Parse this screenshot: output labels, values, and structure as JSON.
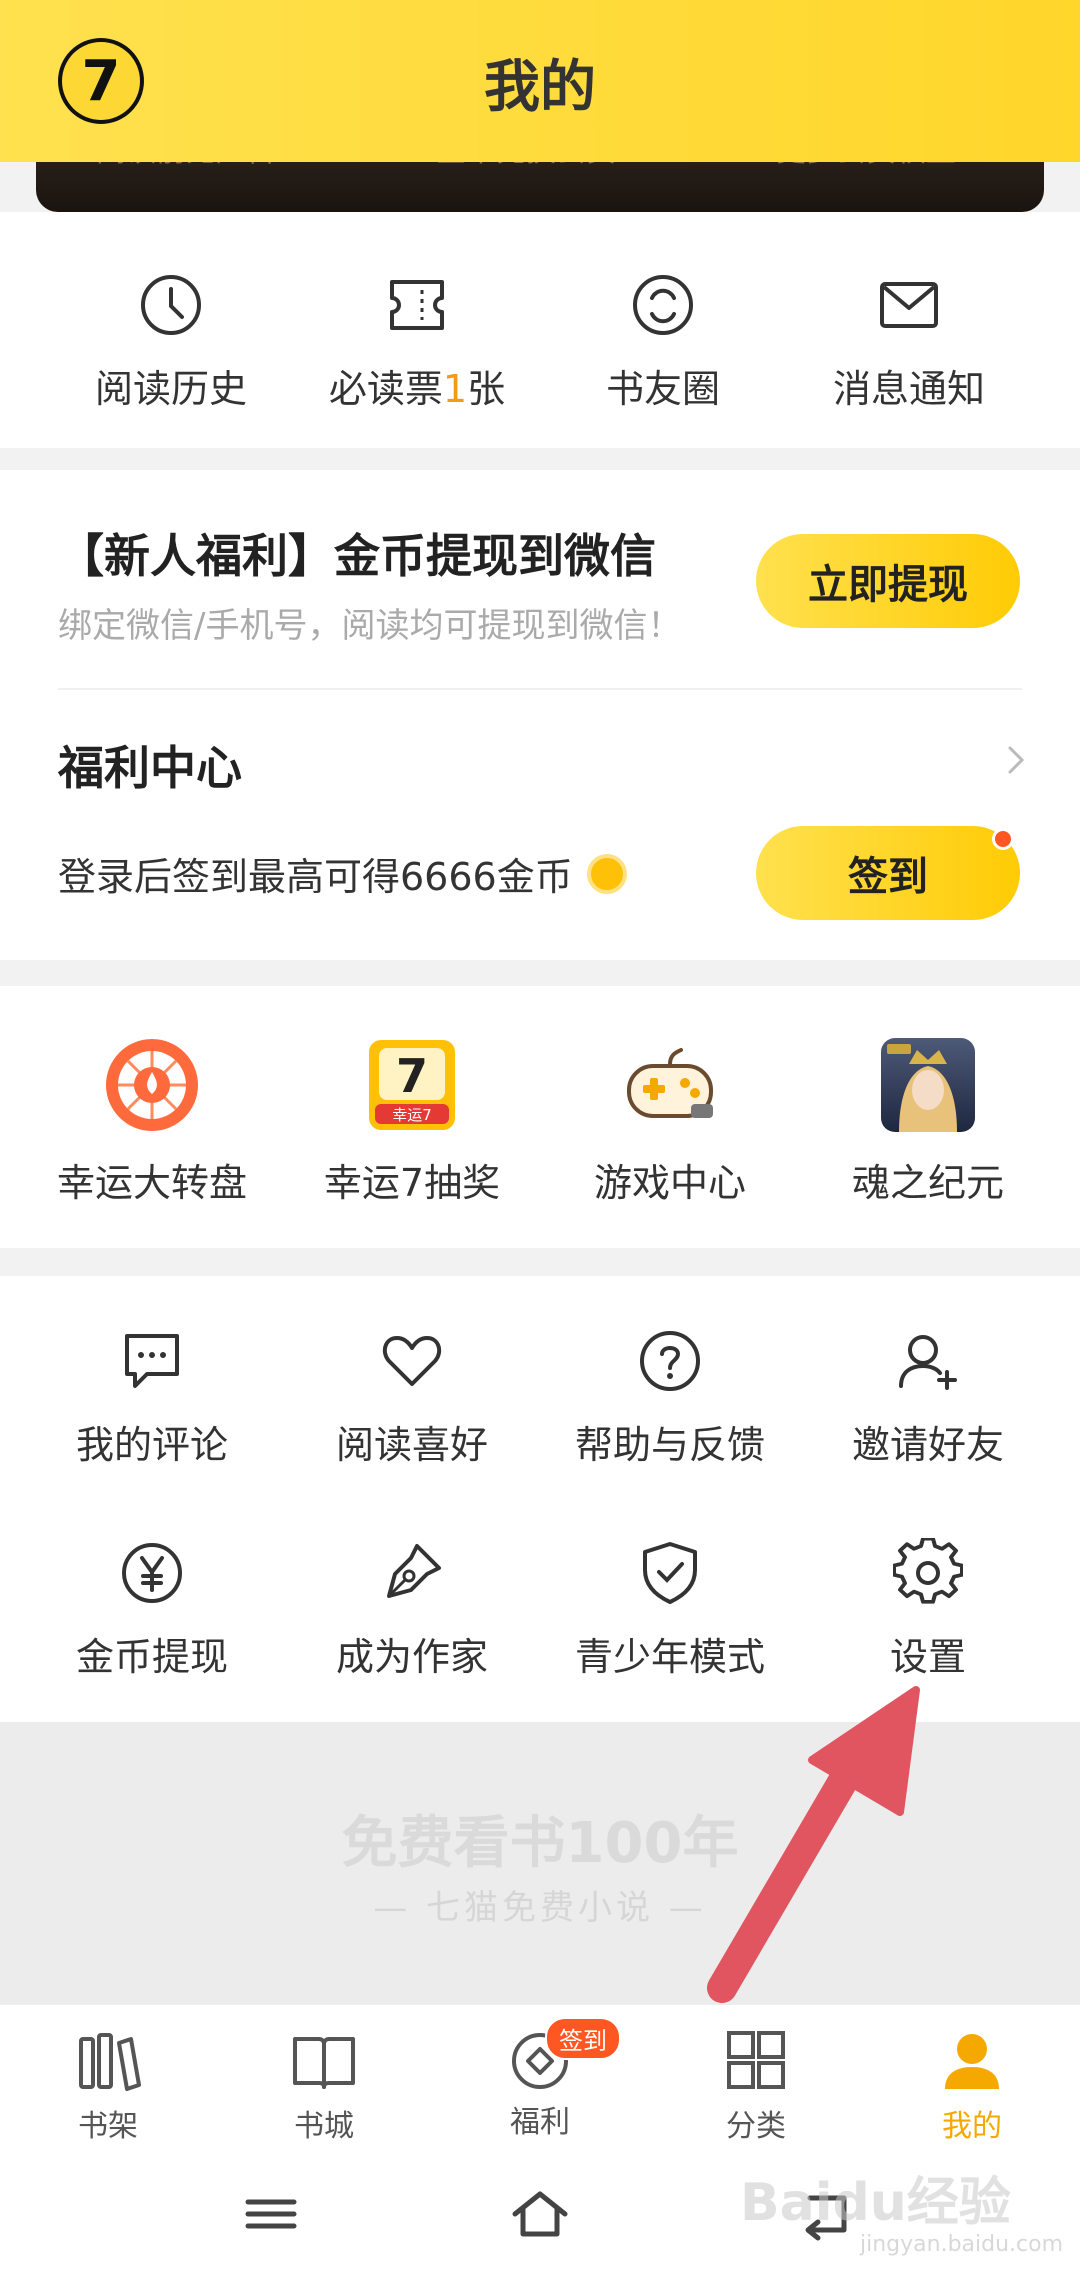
{
  "header": {
    "title": "我的"
  },
  "banner": {
    "items": [
      "阅读前无广告",
      "金币兑换会员",
      "更多会员权益"
    ]
  },
  "quick": [
    {
      "label": "阅读历史",
      "icon": "clock-icon"
    },
    {
      "label_prefix": "必读票",
      "label_count": "1",
      "label_suffix": "张",
      "icon": "ticket-icon"
    },
    {
      "label": "书友圈",
      "icon": "circle-icon"
    },
    {
      "label": "消息通知",
      "icon": "mail-icon"
    }
  ],
  "welfare": {
    "promo_title": "【新人福利】金币提现到微信",
    "promo_sub": "绑定微信/手机号，阅读均可提现到微信！",
    "withdraw_button": "立即提现",
    "center_title": "福利中心",
    "signin_desc": "登录后签到最高可得6666金币",
    "signin_button": "签到"
  },
  "games": [
    {
      "label": "幸运大转盘",
      "icon": "lucky-wheel-icon"
    },
    {
      "label": "幸运7抽奖",
      "icon": "lucky7-icon",
      "icon_text": "幸运7"
    },
    {
      "label": "游戏中心",
      "icon": "gamepad-icon"
    },
    {
      "label": "魂之纪元",
      "icon": "game-avatar-icon"
    }
  ],
  "tools": [
    {
      "label": "我的评论",
      "icon": "comment-icon"
    },
    {
      "label": "阅读喜好",
      "icon": "heart-icon"
    },
    {
      "label": "帮助与反馈",
      "icon": "help-icon"
    },
    {
      "label": "邀请好友",
      "icon": "add-user-icon"
    },
    {
      "label": "金币提现",
      "icon": "yen-coin-icon"
    },
    {
      "label": "成为作家",
      "icon": "pen-icon"
    },
    {
      "label": "青少年模式",
      "icon": "shield-icon"
    },
    {
      "label": "设置",
      "icon": "gear-icon"
    }
  ],
  "slogan": {
    "main": "免费看书100年",
    "sub": "— 七猫免费小说 —"
  },
  "bottom_nav": [
    {
      "label": "书架",
      "icon": "bookshelf-icon"
    },
    {
      "label": "书城",
      "icon": "book-icon"
    },
    {
      "label": "福利",
      "icon": "welfare-icon",
      "badge": "签到"
    },
    {
      "label": "分类",
      "icon": "grid-icon"
    },
    {
      "label": "我的",
      "icon": "user-icon",
      "active": true
    }
  ],
  "colors": {
    "brand_yellow": "#ffd62a",
    "accent_orange": "#f39c12",
    "arrow_red": "#e0555f"
  },
  "watermark": {
    "main": "Baidu经验",
    "sub": "jingyan.baidu.com"
  }
}
